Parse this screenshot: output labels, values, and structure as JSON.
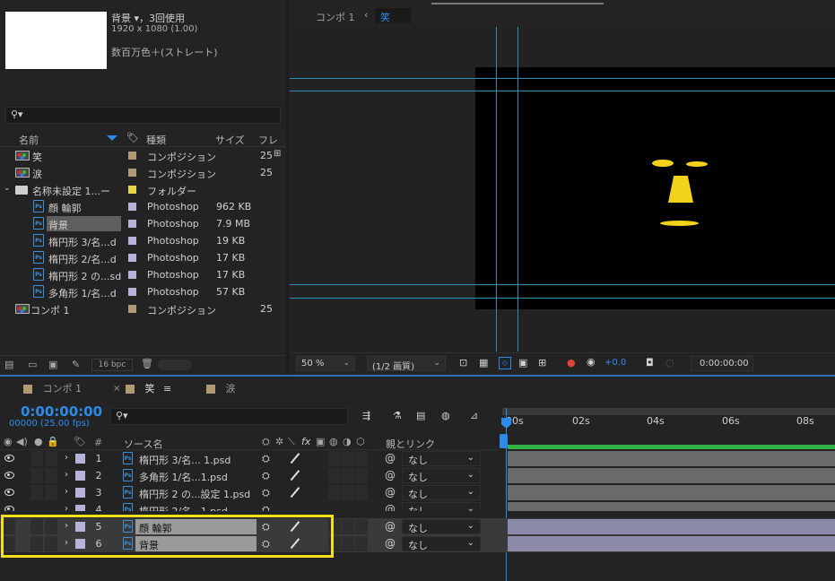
{
  "project": {
    "footage_name": "背景 ▾，3回使用",
    "footage_size": "1920 x 1080 (1.00)",
    "footage_color": "数百万色＋(ストレート)",
    "search_placeholder": "",
    "columns": {
      "name": "名前",
      "type": "種類",
      "size": "サイズ",
      "frame": "フレ"
    },
    "items": [
      {
        "name": "笑",
        "type": "コンポジション",
        "size": "",
        "frame": "25",
        "kind": "comp",
        "tag": "#b09a74"
      },
      {
        "name": "涙",
        "type": "コンポジション",
        "size": "",
        "frame": "25",
        "kind": "comp",
        "tag": "#b09a74"
      },
      {
        "name": "名称未設定 1...ー",
        "type": "フォルダー",
        "size": "",
        "frame": "",
        "kind": "folder",
        "tag": "#e6d449"
      },
      {
        "name": "顔 輪郭",
        "type": "Photoshop",
        "size": "962 KB",
        "frame": "",
        "kind": "ps",
        "tag": "#b5b3d9"
      },
      {
        "name": "背景",
        "type": "Photoshop",
        "size": "7.9 MB",
        "frame": "",
        "kind": "ps",
        "tag": "#b5b3d9"
      },
      {
        "name": "楕円形 3/名...d",
        "type": "Photoshop",
        "size": "19 KB",
        "frame": "",
        "kind": "ps",
        "tag": "#b5b3d9"
      },
      {
        "name": "楕円形 2/名...d",
        "type": "Photoshop",
        "size": "17 KB",
        "frame": "",
        "kind": "ps",
        "tag": "#b5b3d9"
      },
      {
        "name": "楕円形 2 の...sd",
        "type": "Photoshop",
        "size": "17 KB",
        "frame": "",
        "kind": "ps",
        "tag": "#b5b3d9"
      },
      {
        "name": "多角形 1/名...d",
        "type": "Photoshop",
        "size": "57 KB",
        "frame": "",
        "kind": "ps",
        "tag": "#b5b3d9"
      },
      {
        "name": "コンポ 1",
        "type": "コンポジション",
        "size": "",
        "frame": "25",
        "kind": "comp",
        "tag": "#b09a74"
      }
    ],
    "bpc": "16 bpc"
  },
  "viewer": {
    "breadcrumb_parent": "コンポ 1",
    "breadcrumb_current": "笑",
    "zoom": "50 %",
    "resolution": "(1/2 画質)",
    "exposure": "+0.0",
    "timecode": "0:00:00:00"
  },
  "timeline": {
    "tabs": [
      {
        "label": "コンポ 1"
      },
      {
        "label": "笑"
      },
      {
        "label": "涙"
      }
    ],
    "current_time": "0:00:00:00",
    "frame_info": "00000 (25.00 fps)",
    "columns": {
      "num": "#",
      "source": "ソース名",
      "parent": "親とリンク"
    },
    "ruler": [
      "00s",
      "02s",
      "04s",
      "06s",
      "08s"
    ],
    "layers": [
      {
        "num": "1",
        "name": "楕円形 3/名... 1.psd",
        "parent": "なし",
        "selected": false
      },
      {
        "num": "2",
        "name": "多角形 1/名...1.psd",
        "parent": "なし",
        "selected": false
      },
      {
        "num": "3",
        "name": "楕円形 2 の...設定 1.psd",
        "parent": "なし",
        "selected": false
      },
      {
        "num": "4",
        "name": "楕円形 2/名...1.psd",
        "parent": "なし",
        "selected": false
      },
      {
        "num": "5",
        "name": "顔 輪郭",
        "parent": "なし",
        "selected": true
      },
      {
        "num": "6",
        "name": "背景",
        "parent": "なし",
        "selected": true
      }
    ]
  },
  "colors": {
    "accent": "#2d8ceb",
    "highlight_box": "#f2e11a",
    "face_yellow": "#f2d21a"
  }
}
